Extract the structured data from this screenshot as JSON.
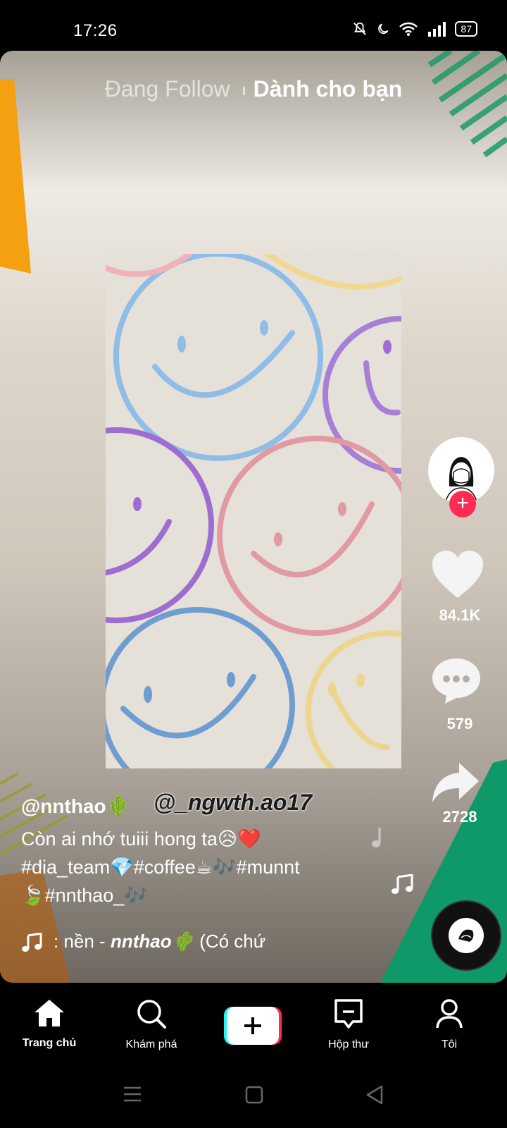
{
  "status_bar": {
    "time": "17:26",
    "battery": "87"
  },
  "top_tabs": {
    "following": "Đang Follow",
    "for_you": "Dành cho bạn"
  },
  "right_rail": {
    "likes": "84.1K",
    "comments": "579",
    "shares": "2728"
  },
  "post": {
    "username": "@nnthao🌵",
    "watermark": "@_ngwth.ao17",
    "description_line1": "Còn ai nhớ tuiii hong ta😥❤️",
    "description_line2": "#dia_team💎#coffee☕🎶#munnt",
    "description_line3": "🍃#nnthao_🎶",
    "music_prefix": ": nền - ",
    "music_author": "nnthao🌵",
    "music_suffix": " (Có chứ"
  },
  "bottom_nav": {
    "home": "Trang chủ",
    "discover": "Khám phá",
    "inbox": "Hộp thư",
    "profile": "Tôi"
  },
  "colors": {
    "accent_red": "#fe2c55",
    "accent_cyan": "#25f4ee"
  },
  "icons": [
    "wifi-icon",
    "signal-icon",
    "mute-icon",
    "moon-icon",
    "heart-icon",
    "comment-icon",
    "share-icon",
    "music-note-icon",
    "home-icon",
    "search-icon",
    "plus-icon",
    "inbox-icon",
    "profile-icon"
  ]
}
